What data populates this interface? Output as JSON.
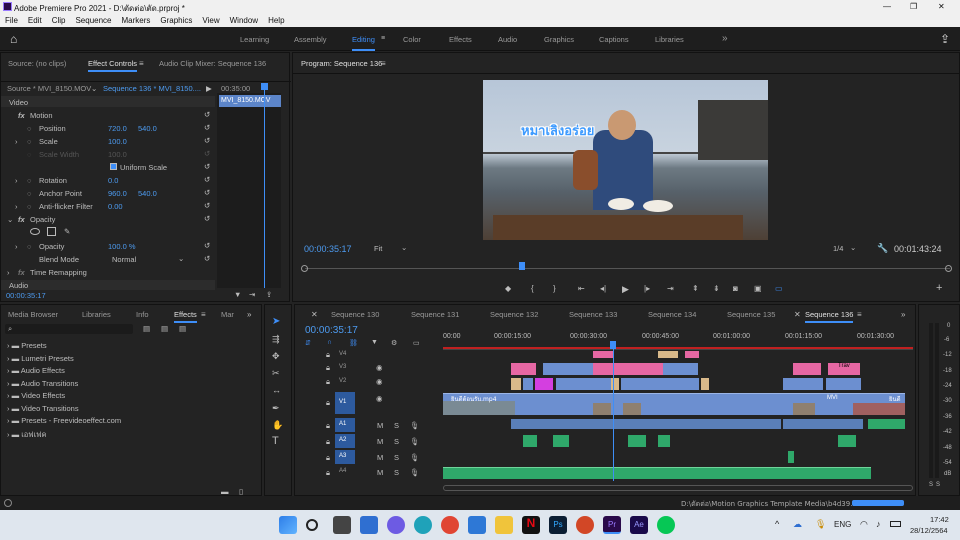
{
  "title_bar": {
    "title": "Adobe Premiere Pro 2021 - D:\\ตัดต่อ\\ตัด.prproj *",
    "min": "—",
    "max": "❐",
    "close": "✕"
  },
  "menu": [
    "File",
    "Edit",
    "Clip",
    "Sequence",
    "Markers",
    "Graphics",
    "View",
    "Window",
    "Help"
  ],
  "workspaces": {
    "home": "⌂",
    "items": [
      "Learning",
      "Assembly",
      "Editing",
      "Color",
      "Effects",
      "Audio",
      "Graphics",
      "Captions",
      "Libraries"
    ],
    "active": "Editing",
    "more": "»",
    "export": "⇪"
  },
  "source_panel": {
    "tabs": [
      "Source: (no clips)",
      "Effect Controls",
      "Audio Clip Mixer: Sequence 136"
    ],
    "source_clip": "Source * MVI_8150.MOV",
    "sequence_link": "Sequence 136 * MVI_8150....",
    "time_start": "00:35:00",
    "clip_label": "MVI_8150.MCV",
    "video_header": "Video",
    "motion": "Motion",
    "position_label": "Position",
    "position_x": "720.0",
    "position_y": "540.0",
    "scale_label": "Scale",
    "scale_val": "100.0",
    "scale_width_label": "Scale Width",
    "scale_width_val": "100.0",
    "uniform_scale": "Uniform Scale",
    "rotation_label": "Rotation",
    "rotation_val": "0.0",
    "anchor_label": "Anchor Point",
    "anchor_x": "960.0",
    "anchor_y": "540.0",
    "antiflicker_label": "Anti-flicker Filter",
    "antiflicker_val": "0.00",
    "opacity": "Opacity",
    "opacity_label": "Opacity",
    "opacity_val": "100.0 %",
    "blend_label": "Blend Mode",
    "blend_val": "Normal",
    "time_remap": "Time Remapping",
    "audio_header": "Audio",
    "timecode": "00:00:35:17"
  },
  "program_panel": {
    "title": "Program: Sequence 136",
    "timecode": "00:00:35:17",
    "fit": "Fit",
    "ratio": "1/4",
    "duration": "00:01:43:24",
    "video_title_text": "หมาเลิงอร่อย"
  },
  "project_panel": {
    "tabs": [
      "Media Browser",
      "Libraries",
      "Info",
      "Effects",
      "Mar"
    ],
    "active_tab": "Effects",
    "items": [
      "Presets",
      "Lumetri Presets",
      "Audio Effects",
      "Audio Transitions",
      "Video Effects",
      "Video Transitions",
      "Presets - Freevideoeffect.com",
      "เอฟเฟค"
    ]
  },
  "timeline": {
    "tabs": [
      "Sequence 130",
      "Sequence 131",
      "Sequence 132",
      "Sequence 133",
      "Sequence 134",
      "Sequence 135",
      "Sequence 136"
    ],
    "active_tab": "Sequence 136",
    "timecode": "00:00:35:17",
    "ruler": [
      "00:00",
      "00:00:15:00",
      "00:00:30:00",
      "00:00:45:00",
      "00:01:00:00",
      "00:01:15:00",
      "00:01:30:00"
    ],
    "tracks": [
      "V4",
      "V3",
      "V2",
      "V1",
      "A1",
      "A2",
      "A3",
      "A4"
    ],
    "clip_text_v1": "ยินดีต้อนรับ.mp4",
    "clip_text_v3": "Trav",
    "clip_text_v1_end": "ยินดี",
    "clip_text_mvi": "MVI"
  },
  "audio_meter": {
    "labels": [
      "0",
      "-6",
      "-12",
      "-18",
      "-24",
      "-30",
      "-36",
      "-42",
      "-48",
      "-54",
      "dB"
    ]
  },
  "status": {
    "path": "D:\\ตัดต่อ\\Motion Graphics Template Media\\b4d39..."
  },
  "taskbar": {
    "lang": "ENG",
    "time": "17:42",
    "date": "28/12/2564",
    "apps": [
      "Ps",
      "Pr",
      "Ae"
    ]
  },
  "colors": {
    "accent": "#3e8ef7",
    "clip_video": "#6c8fd0",
    "clip_pink": "#e667a3",
    "clip_magenta": "#d43fe0",
    "clip_tan": "#d9b98a",
    "clip_audio": "#2fa86a",
    "playhead": "#3e8ef7"
  }
}
